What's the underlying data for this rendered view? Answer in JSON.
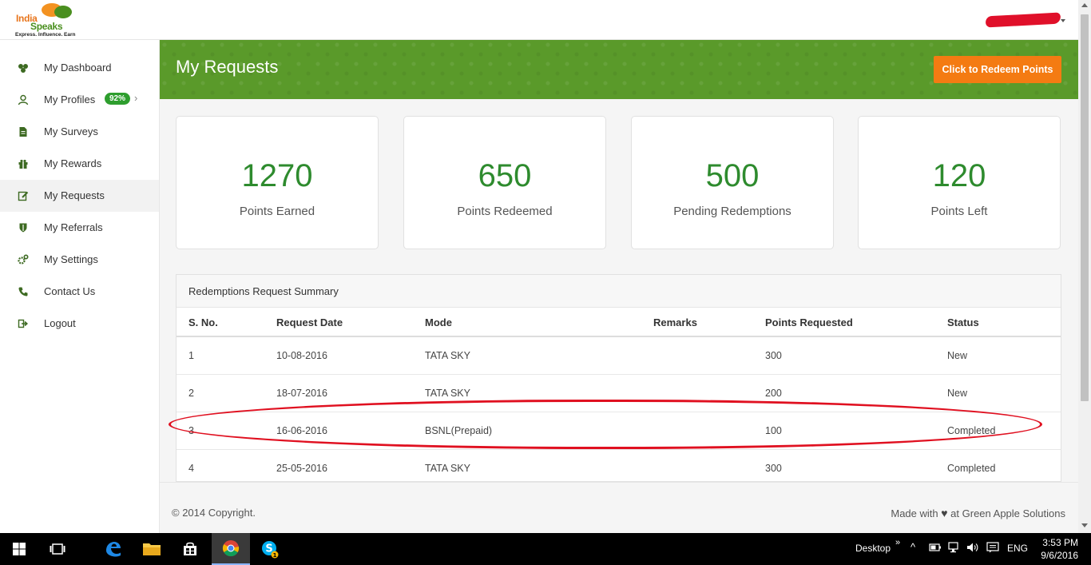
{
  "app": {
    "logo_line1": "India",
    "logo_line2": "Speaks",
    "logo_tagline": "Express. Influence. Earn"
  },
  "sidebar": {
    "items": [
      {
        "label": "My Dashboard",
        "icon": "dashboard-icon"
      },
      {
        "label": "My Profiles",
        "icon": "user-icon",
        "badge": "92%"
      },
      {
        "label": "My Surveys",
        "icon": "document-icon"
      },
      {
        "label": "My Rewards",
        "icon": "gift-icon"
      },
      {
        "label": "My Requests",
        "icon": "edit-icon",
        "active": true
      },
      {
        "label": "My Referrals",
        "icon": "shield-icon"
      },
      {
        "label": "My Settings",
        "icon": "gears-icon"
      },
      {
        "label": "Contact Us",
        "icon": "phone-icon"
      },
      {
        "label": "Logout",
        "icon": "logout-icon"
      }
    ]
  },
  "banner": {
    "title": "My Requests",
    "redeem_button": "Click to Redeem Points"
  },
  "stats": [
    {
      "value": "1270",
      "label": "Points Earned"
    },
    {
      "value": "650",
      "label": "Points Redeemed"
    },
    {
      "value": "500",
      "label": "Pending Redemptions"
    },
    {
      "value": "120",
      "label": "Points Left"
    }
  ],
  "table": {
    "title": "Redemptions Request Summary",
    "columns": [
      "S. No.",
      "Request Date",
      "Mode",
      "Remarks",
      "Points Requested",
      "Status"
    ],
    "rows": [
      [
        "1",
        "10-08-2016",
        "TATA SKY",
        "",
        "300",
        "New"
      ],
      [
        "2",
        "18-07-2016",
        "TATA SKY",
        "",
        "200",
        "New"
      ],
      [
        "3",
        "16-06-2016",
        "BSNL(Prepaid)",
        "",
        "100",
        "Completed"
      ],
      [
        "4",
        "25-05-2016",
        "TATA SKY",
        "",
        "300",
        "Completed"
      ]
    ]
  },
  "footer": {
    "copyright": "© 2014 Copyright.",
    "made_with": "Made with",
    "credit_suffix": "at Green Apple Solutions"
  },
  "taskbar": {
    "desktop_label": "Desktop",
    "language": "ENG",
    "time": "3:53 PM",
    "date": "9/6/2016",
    "skype_badge": "1"
  },
  "colors": {
    "accent_green": "#2e8b2e",
    "banner_green": "#5a9a2a",
    "redeem_orange": "#f47b12",
    "highlight_red": "#e01020"
  }
}
